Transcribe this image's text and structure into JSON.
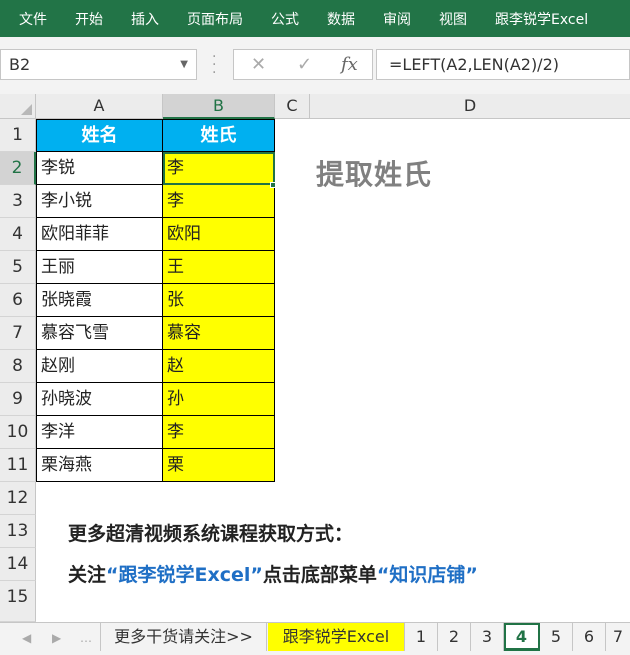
{
  "ribbon": {
    "tabs": [
      "文件",
      "开始",
      "插入",
      "页面布局",
      "公式",
      "数据",
      "审阅",
      "视图",
      "跟李锐学Excel"
    ]
  },
  "formula_bar": {
    "name_box": "B2",
    "formula": "=LEFT(A2,LEN(A2)/2)"
  },
  "columns": [
    "A",
    "B",
    "C",
    "D"
  ],
  "rows": [
    "1",
    "2",
    "3",
    "4",
    "5",
    "6",
    "7",
    "8",
    "9",
    "10",
    "11",
    "12",
    "13",
    "14",
    "15"
  ],
  "table": {
    "headers": [
      "姓名",
      "姓氏"
    ],
    "names": [
      "李锐",
      "李小锐",
      "欧阳菲菲",
      "王丽",
      "张晓霞",
      "慕容飞雪",
      "赵刚",
      "孙晓波",
      "李洋",
      "栗海燕"
    ],
    "surnames": [
      "李",
      "李",
      "欧阳",
      "王",
      "张",
      "慕容",
      "赵",
      "孙",
      "李",
      "栗"
    ]
  },
  "sheet_title": "提取姓氏",
  "promo": {
    "line1": "更多超清视频系统课程获取方式：",
    "line2_prefix": "关注",
    "line2_account": "“跟李锐学Excel”",
    "line2_middle": "点击底部菜单",
    "line2_menu": "“知识店铺”"
  },
  "sheet_tabs": [
    "更多干货请关注>>",
    "跟李锐学Excel",
    "1",
    "2",
    "3",
    "4",
    "5",
    "6",
    "7"
  ],
  "active_sheet": "4",
  "colors": {
    "ribbon": "#227447",
    "header_fill": "#00b0f0",
    "result_fill": "#ffff00",
    "accent_blue": "#1f6fc5"
  }
}
